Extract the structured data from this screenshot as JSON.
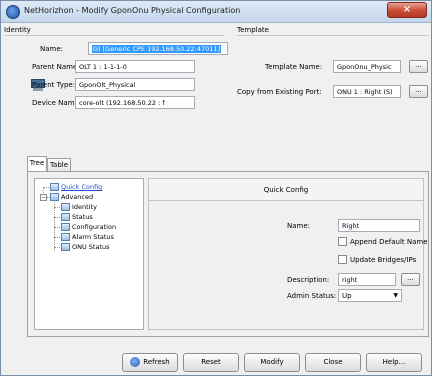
{
  "window": {
    "title": "NetHorizhon - Modify GponOnu Physical Configuration",
    "close_glyph": "×",
    "app_icon": "nethorizhon-logo-icon"
  },
  "identity": {
    "group_label": "Identity",
    "name_label": "Name:",
    "name_value": "G) [Generic CPE 192.168.50.22:47011]",
    "parent_name_label": "Parent Name:",
    "parent_name_value": "OLT 1 : 1-1-1-0",
    "parent_type_label": "Parent Type:",
    "parent_type_value": "GponOlt_Physical",
    "device_name_label": "Device Name:",
    "device_name_value": "core-olt (192.168.50.22 : f"
  },
  "template": {
    "group_label": "Template",
    "template_name_label": "Template Name:",
    "template_name_value": "GponOnu_Physic",
    "copy_label": "Copy from Existing Port:",
    "copy_value": "ONU 1 : Right (S)",
    "browse_label": "..."
  },
  "tabs": [
    {
      "label": "Tree",
      "active": true
    },
    {
      "label": "Table",
      "active": false
    }
  ],
  "tree": {
    "quick_config": "Quick Config",
    "advanced": "Advanced",
    "expand_glyph": "−",
    "children": [
      "Identity",
      "Status",
      "Configuration",
      "Alarm Status",
      "ONU Status"
    ]
  },
  "detail": {
    "title": "Quick Config",
    "name_label": "Name:",
    "name_value": "Right",
    "append_default_name": "Append Default Name",
    "update_bridges": "Update Bridges/IPs",
    "description_label": "Description:",
    "description_value": "right",
    "browse_label": "...",
    "admin_status_label": "Admin Status:",
    "admin_status_value": "Up",
    "dropdown_glyph": "▼"
  },
  "buttons": {
    "refresh": "Refresh",
    "reset": "Reset",
    "modify": "Modify",
    "close": "Close",
    "help": "Help..."
  }
}
